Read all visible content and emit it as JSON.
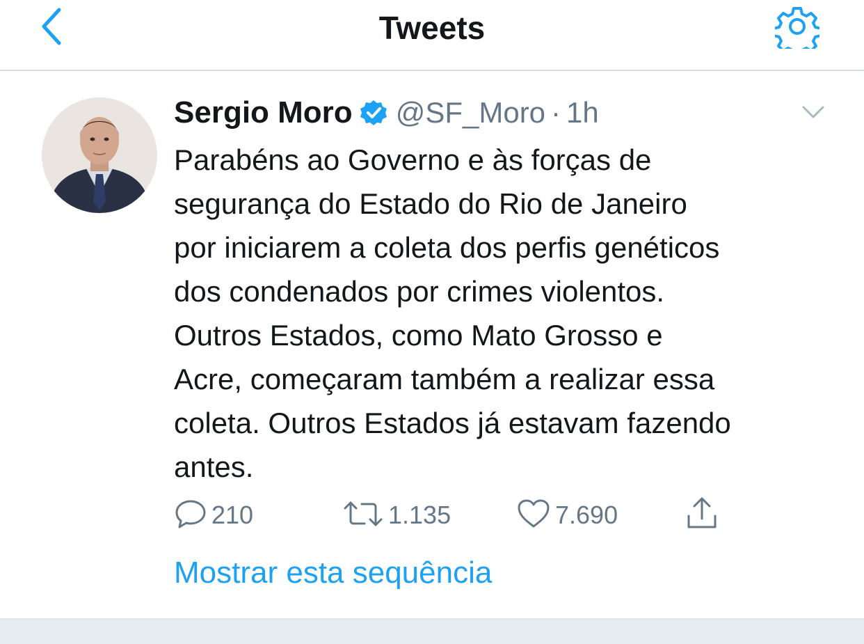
{
  "navbar": {
    "title": "Tweets",
    "back_icon": "chevron-left-icon",
    "settings_icon": "gear-icon",
    "accent_color": "#1da1f2"
  },
  "tweet": {
    "display_name": "Sergio Moro",
    "verified_icon": "verified-badge-icon",
    "handle": "@SF_Moro",
    "separator": "·",
    "time": "1h",
    "text_lines": [
      "Parabéns ao Governo e às forças de",
      "segurança do Estado do Rio de Janeiro",
      "por iniciarem a coleta dos perfis genéticos",
      "dos condenados por crimes violentos.",
      "Outros Estados, como Mato Grosso e",
      "Acre, começaram também a realizar essa",
      "coleta. Outros Estados já estavam fazendo",
      "antes."
    ],
    "actions": {
      "replies": "210",
      "retweets": "1.135",
      "likes": "7.690"
    },
    "show_thread": "Mostrar esta sequência"
  },
  "colors": {
    "accent": "#1da1f2",
    "secondary_text": "#657786",
    "primary_text": "#14171a",
    "divider": "#e6ecf0"
  }
}
